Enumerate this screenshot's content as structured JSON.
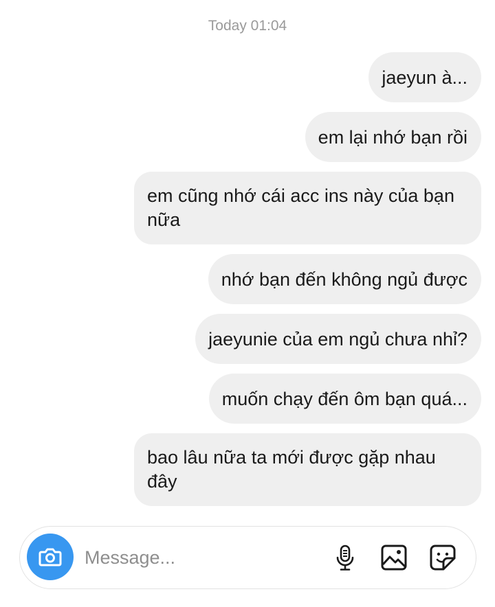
{
  "thread": {
    "timestamp": "Today 01:04",
    "messages": [
      {
        "text": "jaeyun à..."
      },
      {
        "text": "em lại nhớ bạn rồi"
      },
      {
        "text": "em cũng nhớ cái acc ins này của bạn nữa"
      },
      {
        "text": "nhớ bạn đến không ngủ được"
      },
      {
        "text": "jaeyunie của em ngủ chưa nhỉ?"
      },
      {
        "text": "muốn chạy đến ôm bạn quá..."
      },
      {
        "text": "bao lâu nữa ta mới được gặp nhau đây"
      }
    ]
  },
  "composer": {
    "placeholder": "Message...",
    "value": "",
    "icons": {
      "camera": "camera-icon",
      "mic": "microphone-icon",
      "gallery": "gallery-icon",
      "sticker": "sticker-icon"
    },
    "accent_color": "#3897f0"
  },
  "colors": {
    "bubble_background": "#efefef",
    "timestamp_text": "#9a9a9a"
  }
}
